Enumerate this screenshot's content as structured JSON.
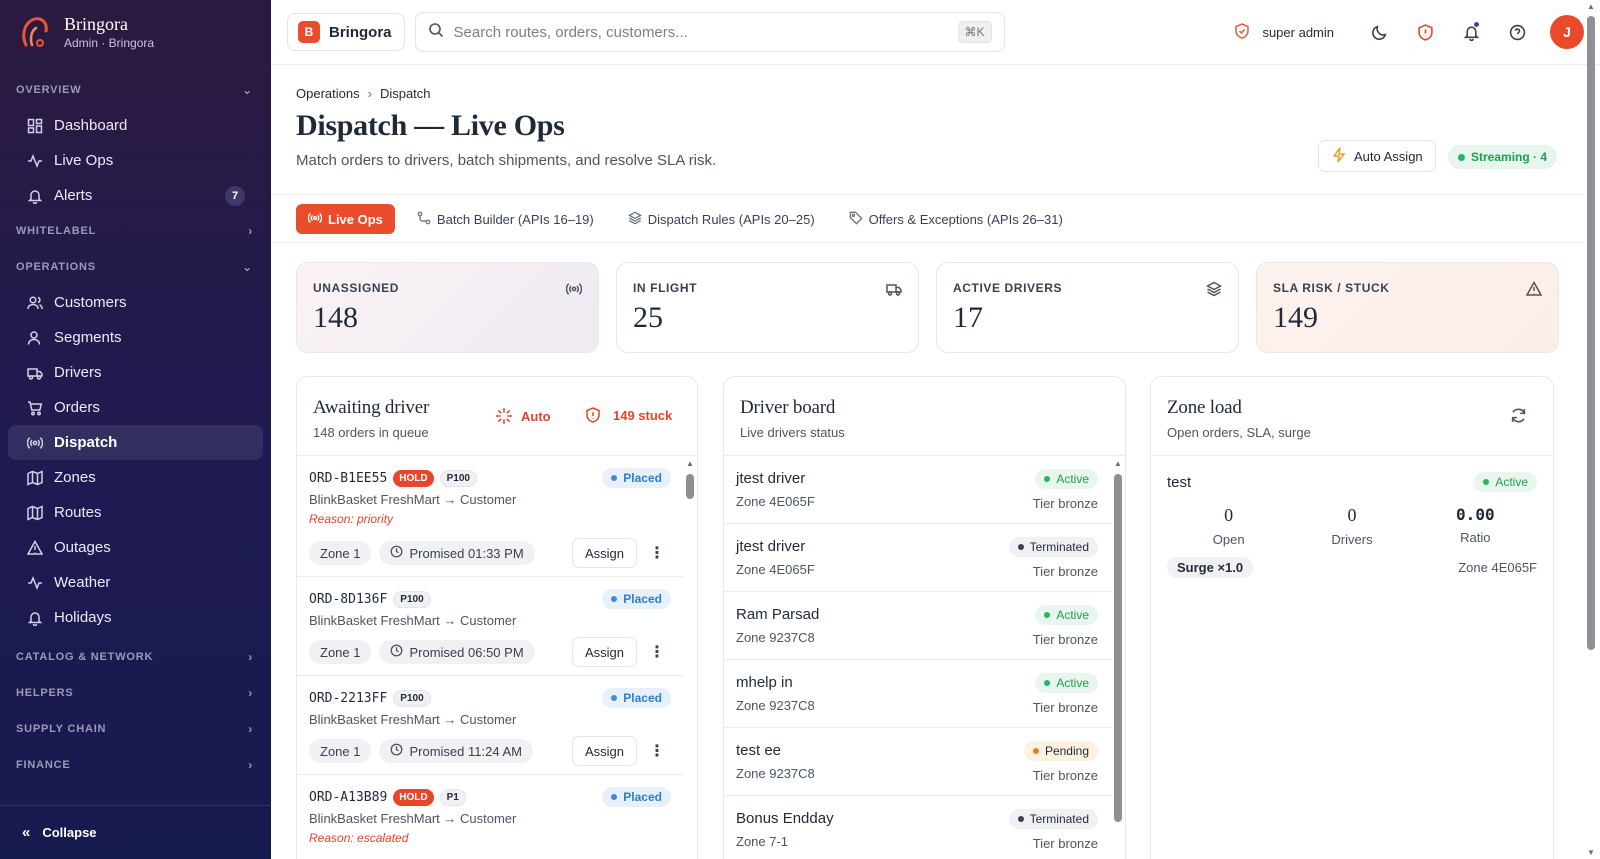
{
  "brand": {
    "name": "Bringora",
    "subtitle": "Admin · Bringora",
    "badge_letter": "B"
  },
  "sidebar": {
    "sections": {
      "overview": "OVERVIEW",
      "whitelabel": "WHITELABEL",
      "operations": "OPERATIONS",
      "catalog": "CATALOG & NETWORK",
      "helpers": "HELPERS",
      "supply": "SUPPLY CHAIN",
      "finance": "FINANCE"
    },
    "overview_items": [
      {
        "label": "Dashboard",
        "icon": "grid-icon"
      },
      {
        "label": "Live Ops",
        "icon": "activity-icon"
      },
      {
        "label": "Alerts",
        "icon": "bell-icon",
        "badge": "7"
      }
    ],
    "operations_items": [
      {
        "label": "Customers",
        "icon": "users-icon"
      },
      {
        "label": "Segments",
        "icon": "segments-icon"
      },
      {
        "label": "Drivers",
        "icon": "truck-icon"
      },
      {
        "label": "Orders",
        "icon": "cart-icon"
      },
      {
        "label": "Dispatch",
        "icon": "broadcast-icon",
        "active": true
      },
      {
        "label": "Zones",
        "icon": "map-icon"
      },
      {
        "label": "Routes",
        "icon": "map-icon"
      },
      {
        "label": "Outages",
        "icon": "warning-icon"
      },
      {
        "label": "Weather",
        "icon": "activity-icon"
      },
      {
        "label": "Holidays",
        "icon": "bell-icon"
      }
    ],
    "collapse_label": "Collapse"
  },
  "topbar": {
    "brand_label": "Bringora",
    "search_placeholder": "Search routes, orders, customers...",
    "shortcut": "⌘K",
    "admin_label": "super admin",
    "avatar_letter": "J"
  },
  "header": {
    "breadcrumb": [
      "Operations",
      "Dispatch"
    ],
    "title": "Dispatch — Live Ops",
    "subtitle": "Match orders to drivers, batch shipments, and resolve SLA risk.",
    "auto_assign_label": "Auto Assign",
    "streaming_label": "Streaming · 4"
  },
  "tabs": [
    {
      "label": "Live Ops",
      "icon": "broadcast-icon",
      "active": true
    },
    {
      "label": "Batch Builder (APIs 16–19)",
      "icon": "route-icon"
    },
    {
      "label": "Dispatch Rules (APIs 20–25)",
      "icon": "layers-icon"
    },
    {
      "label": "Offers & Exceptions (APIs 26–31)",
      "icon": "tag-icon"
    }
  ],
  "stats": [
    {
      "label": "UNASSIGNED",
      "value": "148",
      "icon": "broadcast-icon"
    },
    {
      "label": "IN FLIGHT",
      "value": "25",
      "icon": "truck-icon"
    },
    {
      "label": "ACTIVE DRIVERS",
      "value": "17",
      "icon": "layers-icon"
    },
    {
      "label": "SLA RISK / STUCK",
      "value": "149",
      "icon": "warning-icon"
    }
  ],
  "awaiting": {
    "title": "Awaiting driver",
    "subtitle": "148 orders in queue",
    "auto_label": "Auto",
    "stuck_label": "149 stuck",
    "orders": [
      {
        "id": "ORD-B1EE55",
        "hold": "HOLD",
        "priority": "P100",
        "status": "Placed",
        "route": "BlinkBasket FreshMart → Customer",
        "reason": "Reason: priority",
        "zone": "Zone 1",
        "promised": "Promised 01:33 PM",
        "assign": "Assign"
      },
      {
        "id": "ORD-8D136F",
        "hold": "",
        "priority": "P100",
        "status": "Placed",
        "route": "BlinkBasket FreshMart → Customer",
        "reason": "",
        "zone": "Zone 1",
        "promised": "Promised 06:50 PM",
        "assign": "Assign"
      },
      {
        "id": "ORD-2213FF",
        "hold": "",
        "priority": "P100",
        "status": "Placed",
        "route": "BlinkBasket FreshMart → Customer",
        "reason": "",
        "zone": "Zone 1",
        "promised": "Promised 11:24 AM",
        "assign": "Assign"
      },
      {
        "id": "ORD-A13B89",
        "hold": "HOLD",
        "priority": "P1",
        "status": "Placed",
        "route": "BlinkBasket FreshMart → Customer",
        "reason": "Reason: escalated",
        "zone": "",
        "promised": "",
        "assign": ""
      }
    ]
  },
  "driver_board": {
    "title": "Driver board",
    "subtitle": "Live drivers status",
    "drivers": [
      {
        "name": "jtest driver",
        "zone": "Zone 4E065F",
        "status": "Active",
        "tier": "Tier bronze",
        "kind": "active"
      },
      {
        "name": "jtest driver",
        "zone": "Zone 4E065F",
        "status": "Terminated",
        "tier": "Tier bronze",
        "kind": "term"
      },
      {
        "name": "Ram Parsad",
        "zone": "Zone 9237C8",
        "status": "Active",
        "tier": "Tier bronze",
        "kind": "active"
      },
      {
        "name": "mhelp in",
        "zone": "Zone 9237C8",
        "status": "Active",
        "tier": "Tier bronze",
        "kind": "active"
      },
      {
        "name": "test ee",
        "zone": "Zone 9237C8",
        "status": "Pending",
        "tier": "Tier bronze",
        "kind": "pend"
      },
      {
        "name": "Bonus Endday",
        "zone": "Zone 7-1",
        "status": "Terminated",
        "tier": "Tier bronze",
        "kind": "term"
      }
    ]
  },
  "zone_load": {
    "title": "Zone load",
    "subtitle": "Open orders, SLA, surge",
    "zones": [
      {
        "name": "test",
        "status": "Active",
        "open": "0",
        "open_label": "Open",
        "drivers": "0",
        "drivers_label": "Drivers",
        "ratio": "0.00",
        "ratio_label": "Ratio",
        "surge": "Surge ×1.0",
        "zone_id": "Zone 4E065F"
      }
    ]
  },
  "colors": {
    "accent": "#ea4d2c",
    "sidebar_top": "#2b1a3f",
    "sidebar_bottom": "#171a4f",
    "active_green": "#1f9d55",
    "placed_blue": "#2b7fd0"
  }
}
